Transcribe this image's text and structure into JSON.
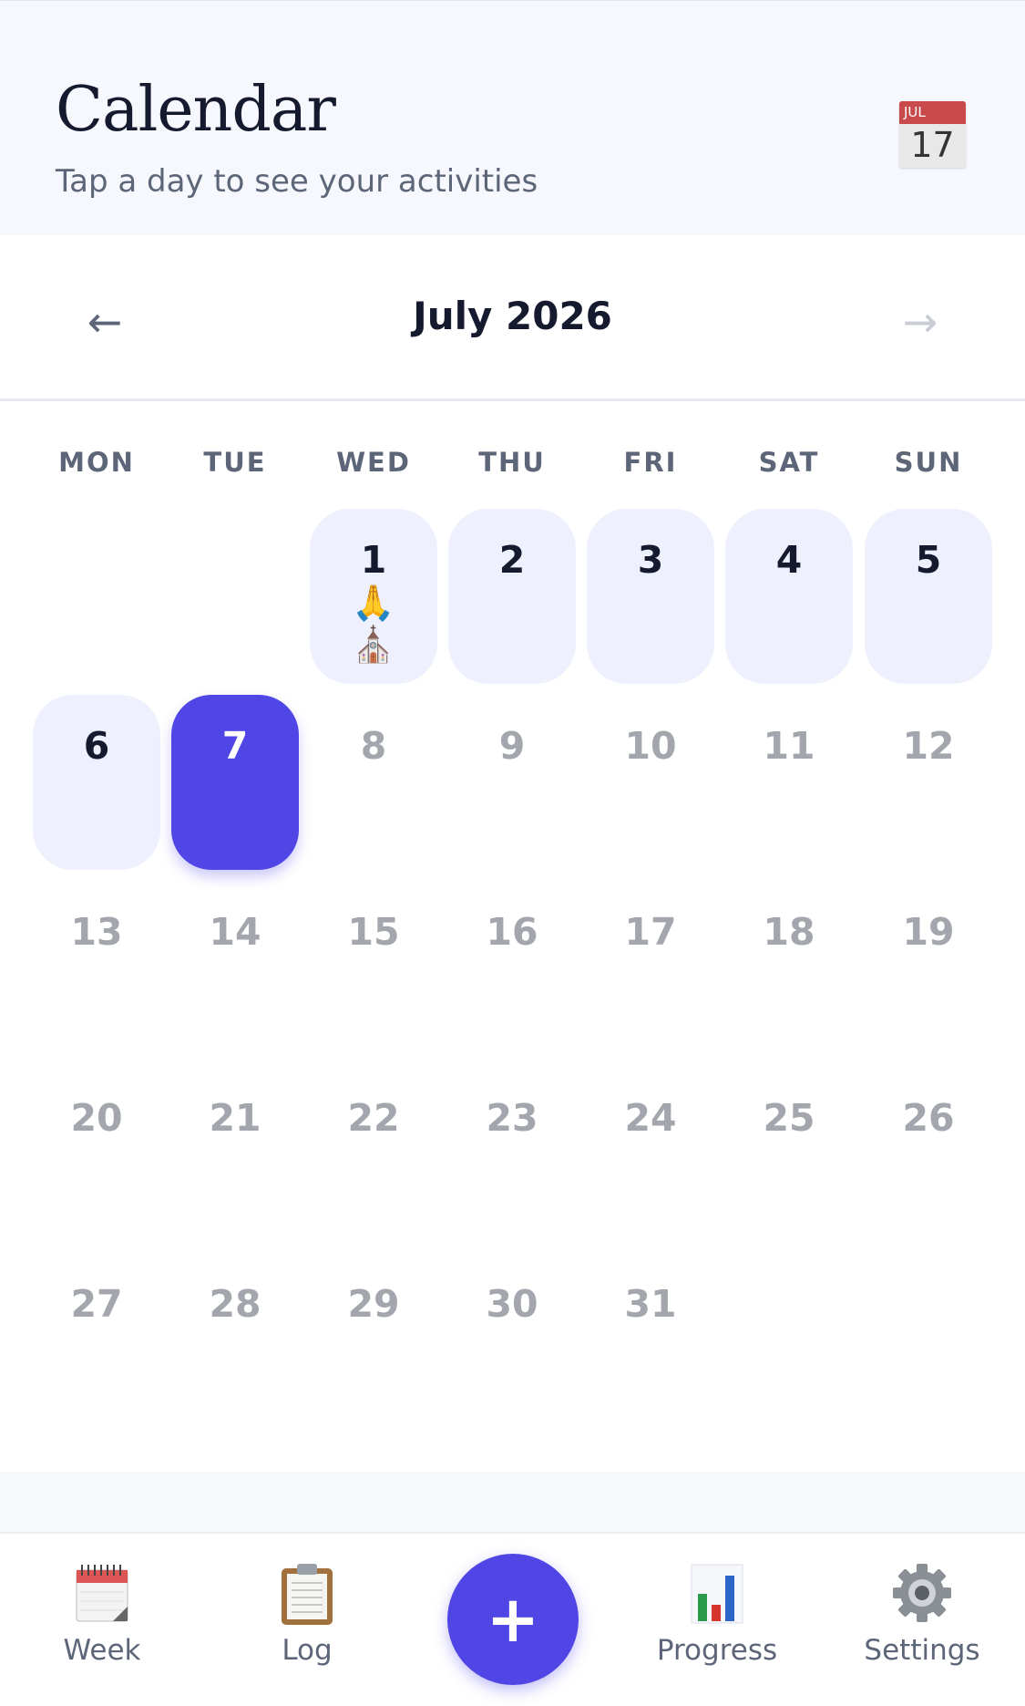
{
  "header": {
    "title": "Calendar",
    "subtitle": "Tap a day to see your activities",
    "calendar_icon": {
      "name": "calendar-icon",
      "month": "JUL",
      "day": "17"
    }
  },
  "month_nav": {
    "label": "July 2026",
    "prev_icon": "arrow-left-icon",
    "next_icon": "arrow-right-icon"
  },
  "weekdays": [
    "MON",
    "TUE",
    "WED",
    "THU",
    "FRI",
    "SAT",
    "SUN"
  ],
  "days": [
    {
      "num": "1",
      "state": "active",
      "emojis": [
        "🙏",
        "⛪"
      ]
    },
    {
      "num": "2",
      "state": "active",
      "emojis": []
    },
    {
      "num": "3",
      "state": "active",
      "emojis": []
    },
    {
      "num": "4",
      "state": "active",
      "emojis": []
    },
    {
      "num": "5",
      "state": "active",
      "emojis": []
    },
    {
      "num": "6",
      "state": "active",
      "emojis": []
    },
    {
      "num": "7",
      "state": "selected",
      "emojis": []
    },
    {
      "num": "8",
      "state": "inactive",
      "emojis": []
    },
    {
      "num": "9",
      "state": "inactive",
      "emojis": []
    },
    {
      "num": "10",
      "state": "inactive",
      "emojis": []
    },
    {
      "num": "11",
      "state": "inactive",
      "emojis": []
    },
    {
      "num": "12",
      "state": "inactive",
      "emojis": []
    },
    {
      "num": "13",
      "state": "inactive",
      "emojis": []
    },
    {
      "num": "14",
      "state": "inactive",
      "emojis": []
    },
    {
      "num": "15",
      "state": "inactive",
      "emojis": []
    },
    {
      "num": "16",
      "state": "inactive",
      "emojis": []
    },
    {
      "num": "17",
      "state": "inactive",
      "emojis": []
    },
    {
      "num": "18",
      "state": "inactive",
      "emojis": []
    },
    {
      "num": "19",
      "state": "inactive",
      "emojis": []
    },
    {
      "num": "20",
      "state": "inactive",
      "emojis": []
    },
    {
      "num": "21",
      "state": "inactive",
      "emojis": []
    },
    {
      "num": "22",
      "state": "inactive",
      "emojis": []
    },
    {
      "num": "23",
      "state": "inactive",
      "emojis": []
    },
    {
      "num": "24",
      "state": "inactive",
      "emojis": []
    },
    {
      "num": "25",
      "state": "inactive",
      "emojis": []
    },
    {
      "num": "26",
      "state": "inactive",
      "emojis": []
    },
    {
      "num": "27",
      "state": "inactive",
      "emojis": []
    },
    {
      "num": "28",
      "state": "inactive",
      "emojis": []
    },
    {
      "num": "29",
      "state": "inactive",
      "emojis": []
    },
    {
      "num": "30",
      "state": "inactive",
      "emojis": []
    },
    {
      "num": "31",
      "state": "inactive",
      "emojis": []
    }
  ],
  "tabbar": {
    "items": [
      {
        "label": "Week",
        "icon": "spiral-calendar-icon"
      },
      {
        "label": "Log",
        "icon": "clipboard-icon"
      },
      {
        "label": "Progress",
        "icon": "bar-chart-icon"
      },
      {
        "label": "Settings",
        "icon": "gear-icon"
      }
    ],
    "fab": {
      "label": "+",
      "icon": "plus-icon"
    }
  },
  "colors": {
    "accent": "#5046e5",
    "active_day_bg": "#eef0fd",
    "text_primary": "#151a2e",
    "text_secondary": "#5d6679",
    "text_muted": "#a3a6ad"
  }
}
